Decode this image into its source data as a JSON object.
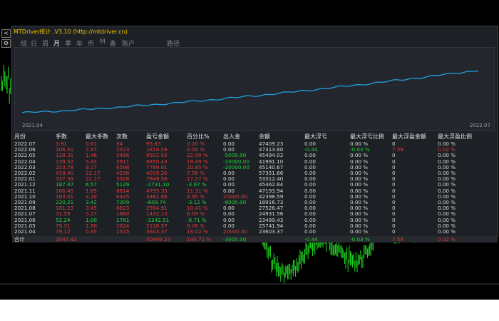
{
  "window": {
    "title": "MTDriver统计 ,V3.10 (http://mtdriver.cn)",
    "side_buttons": [
      "<",
      "⚙"
    ]
  },
  "tabs": [
    {
      "label": "综",
      "active": false
    },
    {
      "label": "日",
      "active": false
    },
    {
      "label": "周",
      "active": false
    },
    {
      "label": "月",
      "active": true
    },
    {
      "label": "季",
      "active": false
    },
    {
      "label": "年",
      "active": false
    },
    {
      "label": "币",
      "active": false
    },
    {
      "label": "M",
      "active": false
    },
    {
      "label": "备",
      "active": false
    },
    {
      "label": "账户",
      "active": false
    },
    {
      "label": "路径",
      "active": false
    }
  ],
  "mini_chart": {
    "start_label": "2021.04",
    "end_label": "2022.07",
    "line_color": "#1f9fe0",
    "balance_series": [
      23603.37,
      25741.94,
      24931.56,
      23499.43,
      27526.47,
      18916.73,
      42398.59,
      47193.94,
      45462.84,
      53312.4,
      57351.66,
      45140.67,
      41991.1,
      45494.02,
      47313.6,
      47409.23
    ]
  },
  "table": {
    "headers": [
      "月份",
      "手数",
      "最大手数",
      "次数",
      "盈亏金额",
      "百分比%",
      "出入金",
      "余额",
      "最大浮亏",
      "最大浮亏比例",
      "最大浮盈金额",
      "最大浮盈比例"
    ],
    "rows": [
      {
        "month": "2022.07",
        "lots": "3.91",
        "max_lots": "0.61",
        "count": "54",
        "pnl": "95.63",
        "pct": "0.20 %",
        "deposit": "0.00",
        "balance": "47409.23",
        "max_float_loss": "0.00",
        "max_float_loss_pct": "0.00 %",
        "max_float_profit": "0",
        "max_float_profit_pct": "0.00 %",
        "pnl_color": "red",
        "float_color": "white"
      },
      {
        "month": "2022.06",
        "lots": "106.51",
        "max_lots": "2.47",
        "count": "2523",
        "pnl": "1819.58",
        "pct": "4.00 %",
        "deposit": "0.00",
        "balance": "47313.60",
        "max_float_loss": "-0.44",
        "max_float_loss_pct": "-0.03 %",
        "max_float_profit": "7.58",
        "max_float_profit_pct": "0.02 %",
        "pnl_color": "red",
        "float_color": "mixed"
      },
      {
        "month": "2022.05",
        "lots": "128.31",
        "max_lots": "1.46",
        "count": "3496",
        "pnl": "8502.92",
        "pct": "22.99 %",
        "deposit": "-5000.00",
        "balance": "45494.02",
        "max_float_loss": "0.00",
        "max_float_loss_pct": "0.00 %",
        "max_float_profit": "0",
        "max_float_profit_pct": "0.00 %",
        "pnl_color": "red",
        "float_color": "white"
      },
      {
        "month": "2022.04",
        "lots": "139.32",
        "max_lots": "5.43",
        "count": "3911",
        "pnl": "6850.43",
        "pct": "19.49 %",
        "deposit": "-10000.00",
        "balance": "41991.10",
        "max_float_loss": "0.00",
        "max_float_loss_pct": "0.00 %",
        "max_float_profit": "0",
        "max_float_profit_pct": "0.00 %",
        "pnl_color": "red",
        "float_color": "white"
      },
      {
        "month": "2022.03",
        "lots": "253.78",
        "max_lots": "9.17",
        "count": "6588",
        "pnl": "7789.01",
        "pct": "20.85 %",
        "deposit": "-20000.00",
        "balance": "45140.67",
        "max_float_loss": "0.00",
        "max_float_loss_pct": "0.00 %",
        "max_float_profit": "0",
        "max_float_profit_pct": "0.00 %",
        "pnl_color": "red",
        "float_color": "white"
      },
      {
        "month": "2022.02",
        "lots": "419.40",
        "max_lots": "22.17",
        "count": "4238",
        "pnl": "4039.26",
        "pct": "7.58 %",
        "deposit": "0.00",
        "balance": "57351.66",
        "max_float_loss": "0.00",
        "max_float_loss_pct": "0.00 %",
        "max_float_profit": "0",
        "max_float_profit_pct": "0.00 %",
        "pnl_color": "red",
        "float_color": "white"
      },
      {
        "month": "2022.01",
        "lots": "337.39",
        "max_lots": "22.17",
        "count": "3926",
        "pnl": "7849.56",
        "pct": "17.27 %",
        "deposit": "0.00",
        "balance": "53312.40",
        "max_float_loss": "0.00",
        "max_float_loss_pct": "0.00 %",
        "max_float_profit": "0",
        "max_float_profit_pct": "0.00 %",
        "pnl_color": "red",
        "float_color": "white"
      },
      {
        "month": "2021.12",
        "lots": "187.47",
        "max_lots": "6.57",
        "count": "5129",
        "pnl": "-1731.10",
        "pct": "-3.67 %",
        "deposit": "0.00",
        "balance": "45462.84",
        "max_float_loss": "0.00",
        "max_float_loss_pct": "0.00 %",
        "max_float_profit": "0",
        "max_float_profit_pct": "0.00 %",
        "pnl_color": "green",
        "float_color": "white"
      },
      {
        "month": "2021.11",
        "lots": "166.45",
        "max_lots": "1.65",
        "count": "8614",
        "pnl": "4795.35",
        "pct": "11.31 %",
        "deposit": "0.00",
        "balance": "47193.94",
        "max_float_loss": "0.00",
        "max_float_loss_pct": "0.00 %",
        "max_float_profit": "0",
        "max_float_profit_pct": "0.00 %",
        "pnl_color": "red",
        "float_color": "white"
      },
      {
        "month": "2021.10",
        "lots": "163.01",
        "max_lots": "4.10",
        "count": "6445",
        "pnl": "3481.86",
        "pct": "8.95 %",
        "deposit": "20000.00",
        "balance": "42398.59",
        "max_float_loss": "0.00",
        "max_float_loss_pct": "0.00 %",
        "max_float_profit": "0",
        "max_float_profit_pct": "0.00 %",
        "pnl_color": "red",
        "float_color": "white"
      },
      {
        "month": "2021.09",
        "lots": "220.21",
        "max_lots": "3.42",
        "count": "7309",
        "pnl": "-609.74",
        "pct": "-3.12 %",
        "deposit": "-8000.00",
        "balance": "18916.73",
        "max_float_loss": "0.00",
        "max_float_loss_pct": "0.00 %",
        "max_float_profit": "0",
        "max_float_profit_pct": "0.00 %",
        "pnl_color": "green",
        "float_color": "white"
      },
      {
        "month": "2021.08",
        "lots": "181.23",
        "max_lots": "3.45",
        "count": "6623",
        "pnl": "2594.91",
        "pct": "10.41 %",
        "deposit": "0.00",
        "balance": "27526.47",
        "max_float_loss": "0.00",
        "max_float_loss_pct": "0.00 %",
        "max_float_profit": "0",
        "max_float_profit_pct": "0.00 %",
        "pnl_color": "red",
        "float_color": "white"
      },
      {
        "month": "2021.07",
        "lots": "31.59",
        "max_lots": "0.27",
        "count": "1860",
        "pnl": "1432.13",
        "pct": "6.09 %",
        "deposit": "0.00",
        "balance": "24931.56",
        "max_float_loss": "0.00",
        "max_float_loss_pct": "0.00 %",
        "max_float_profit": "0",
        "max_float_profit_pct": "0.00 %",
        "pnl_color": "red",
        "float_color": "white"
      },
      {
        "month": "2021.06",
        "lots": "52.24",
        "max_lots": "1.00",
        "count": "1781",
        "pnl": "-2242.51",
        "pct": "-8.71 %",
        "deposit": "0.00",
        "balance": "23499.43",
        "max_float_loss": "0.00",
        "max_float_loss_pct": "0.00 %",
        "max_float_profit": "0",
        "max_float_profit_pct": "0.00 %",
        "pnl_color": "green",
        "float_color": "white"
      },
      {
        "month": "2021.05",
        "lots": "79.31",
        "max_lots": "1.80",
        "count": "1824",
        "pnl": "2138.57",
        "pct": "9.06 %",
        "deposit": "0.00",
        "balance": "25741.94",
        "max_float_loss": "0.00",
        "max_float_loss_pct": "0.00 %",
        "max_float_profit": "0",
        "max_float_profit_pct": "0.00 %",
        "pnl_color": "red",
        "float_color": "white"
      },
      {
        "month": "2021.04",
        "lots": "79.12",
        "max_lots": "0.95",
        "count": "1515",
        "pnl": "3603.37",
        "pct": "18.02 %",
        "deposit": "20000.00",
        "balance": "23603.37",
        "max_float_loss": "0.00",
        "max_float_loss_pct": "0.00 %",
        "max_float_profit": "0",
        "max_float_profit_pct": "0.00 %",
        "pnl_color": "red",
        "float_color": "white"
      }
    ],
    "total": {
      "label": "合计",
      "lots": "2547.42",
      "max_lots": "",
      "count": "",
      "pnl": "50409.23",
      "pct": "140.71 %",
      "deposit": "-3000.00",
      "balance": "",
      "max_float_loss": "-0.44",
      "max_float_loss_pct": "-0.03 %",
      "max_float_profit": "7.58",
      "max_float_profit_pct": "0.02 %"
    }
  },
  "colors": {
    "positive": "#e23a3a",
    "negative": "#27d23a",
    "neutral": "#d8d8d8",
    "title": "#f0c800",
    "background_chart": "#000000",
    "candles": "#22e022"
  }
}
